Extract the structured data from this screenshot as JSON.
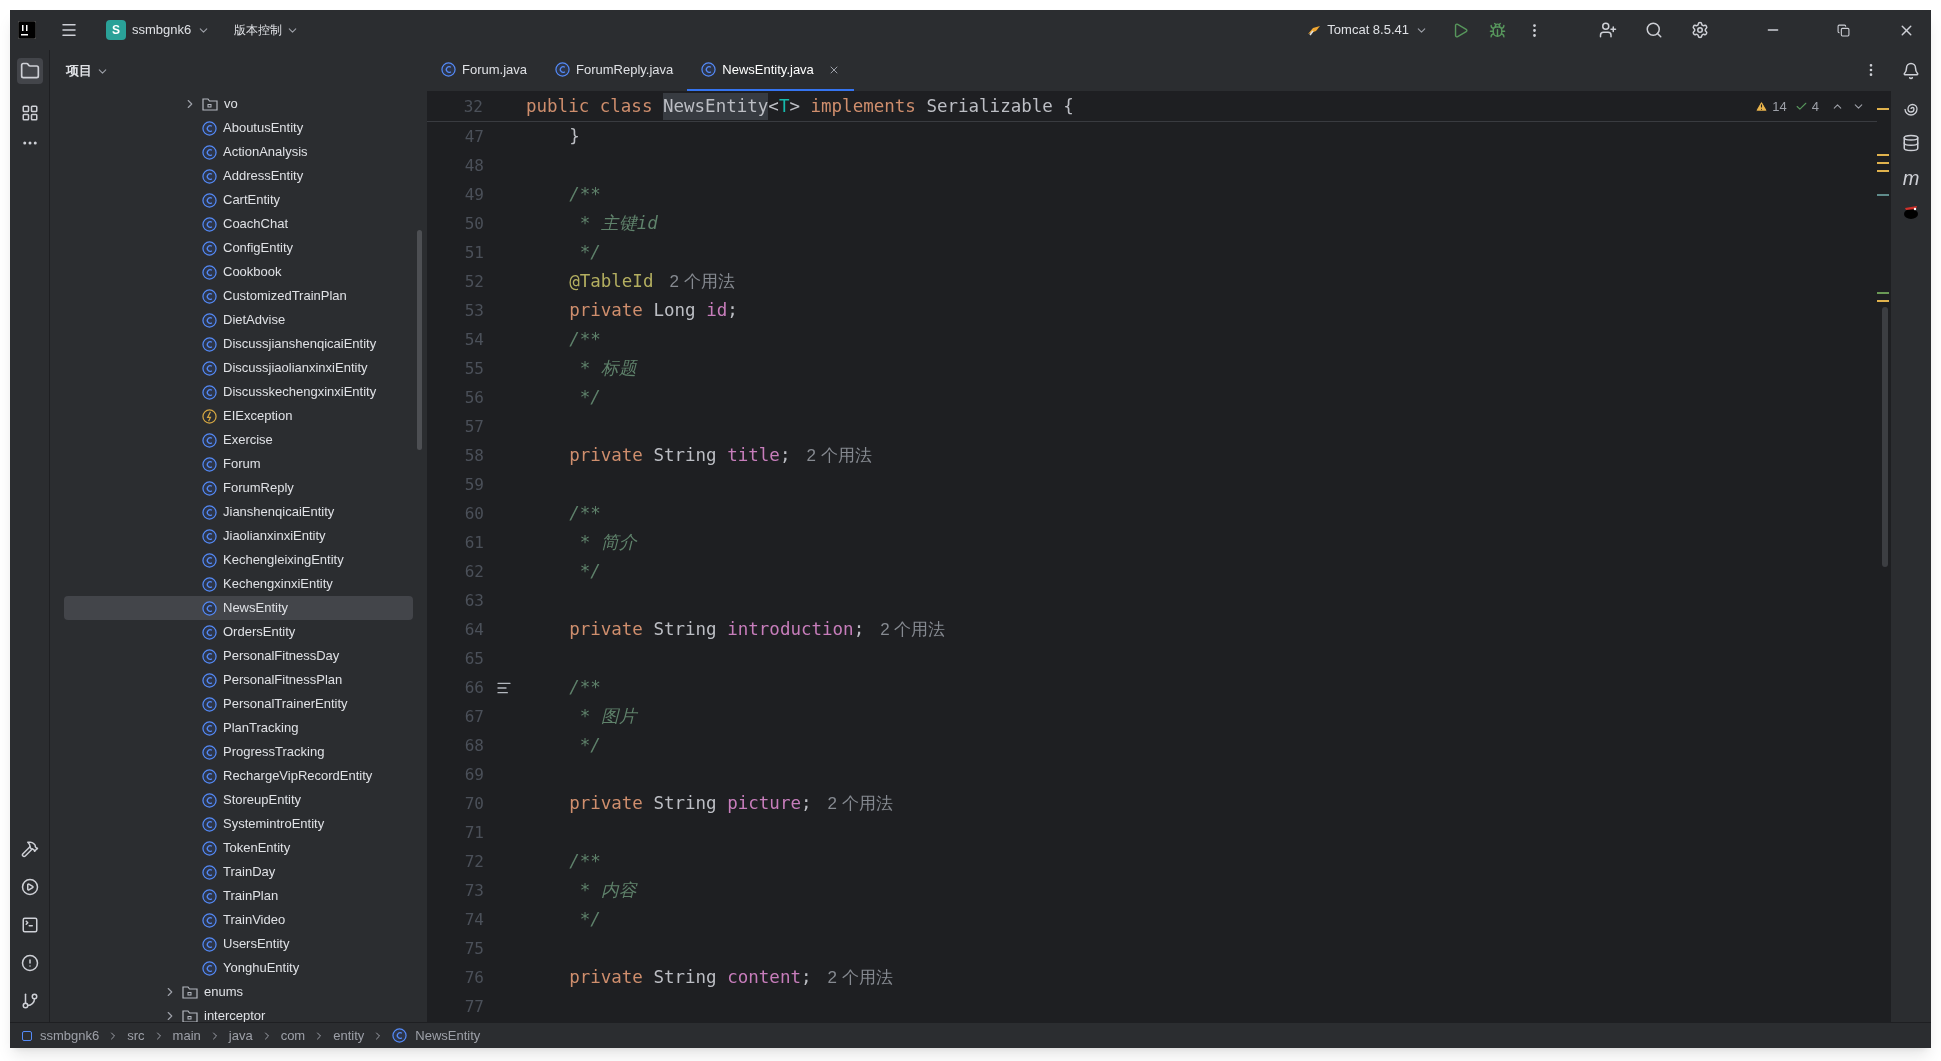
{
  "title_bar": {
    "project_badge": "S",
    "project": "ssmbgnk6",
    "vcs": "版本控制",
    "run_config": "Tomcat 8.5.41"
  },
  "project_panel": {
    "title": "项目",
    "tree": [
      {
        "children": [
          {
            "label": "vo",
            "kind": "folder",
            "expanded": false,
            "selected": false
          },
          {
            "label": "AboutusEntity",
            "kind": "class",
            "selected": false
          },
          {
            "label": "ActionAnalysis",
            "kind": "class",
            "selected": false
          },
          {
            "label": "AddressEntity",
            "kind": "class",
            "selected": false
          },
          {
            "label": "CartEntity",
            "kind": "class",
            "selected": false
          },
          {
            "label": "CoachChat",
            "kind": "class",
            "selected": false
          },
          {
            "label": "ConfigEntity",
            "kind": "class",
            "selected": false
          },
          {
            "label": "Cookbook",
            "kind": "class",
            "selected": false
          },
          {
            "label": "CustomizedTrainPlan",
            "kind": "class",
            "selected": false
          },
          {
            "label": "DietAdvise",
            "kind": "class",
            "selected": false
          },
          {
            "label": "DiscussjianshenqicaiEntity",
            "kind": "class",
            "selected": false
          },
          {
            "label": "DiscussjiaolianxinxiEntity",
            "kind": "class",
            "selected": false
          },
          {
            "label": "DiscusskechengxinxiEntity",
            "kind": "class",
            "selected": false
          },
          {
            "label": "EIException",
            "kind": "exception",
            "selected": false
          },
          {
            "label": "Exercise",
            "kind": "class",
            "selected": false
          },
          {
            "label": "Forum",
            "kind": "class",
            "selected": false
          },
          {
            "label": "ForumReply",
            "kind": "class",
            "selected": false
          },
          {
            "label": "JianshenqicaiEntity",
            "kind": "class",
            "selected": false
          },
          {
            "label": "JiaolianxinxiEntity",
            "kind": "class",
            "selected": false
          },
          {
            "label": "KechengleixingEntity",
            "kind": "class",
            "selected": false
          },
          {
            "label": "KechengxinxiEntity",
            "kind": "class",
            "selected": false
          },
          {
            "label": "NewsEntity",
            "kind": "class",
            "selected": true
          },
          {
            "label": "OrdersEntity",
            "kind": "class",
            "selected": false
          },
          {
            "label": "PersonalFitnessDay",
            "kind": "class",
            "selected": false
          },
          {
            "label": "PersonalFitnessPlan",
            "kind": "class",
            "selected": false
          },
          {
            "label": "PersonalTrainerEntity",
            "kind": "class",
            "selected": false
          },
          {
            "label": "PlanTracking",
            "kind": "class",
            "selected": false
          },
          {
            "label": "ProgressTracking",
            "kind": "class",
            "selected": false
          },
          {
            "label": "RechargeVipRecordEntity",
            "kind": "class",
            "selected": false
          },
          {
            "label": "StoreupEntity",
            "kind": "class",
            "selected": false
          },
          {
            "label": "SystemintroEntity",
            "kind": "class",
            "selected": false
          },
          {
            "label": "TokenEntity",
            "kind": "class",
            "selected": false
          },
          {
            "label": "TrainDay",
            "kind": "class",
            "selected": false
          },
          {
            "label": "TrainPlan",
            "kind": "class",
            "selected": false
          },
          {
            "label": "TrainVideo",
            "kind": "class",
            "selected": false
          },
          {
            "label": "UsersEntity",
            "kind": "class",
            "selected": false
          },
          {
            "label": "YonghuEntity",
            "kind": "class",
            "selected": false
          }
        ]
      },
      {
        "label": "enums",
        "kind": "folder",
        "expanded": false,
        "selected": false
      },
      {
        "label": "interceptor",
        "kind": "folder",
        "expanded": false,
        "selected": false
      }
    ]
  },
  "tabs": [
    {
      "label": "Forum.java",
      "selected": false
    },
    {
      "label": "ForumReply.java",
      "selected": false
    },
    {
      "label": "NewsEntity.java",
      "selected": true
    }
  ],
  "inspections": {
    "warnings": "14",
    "weak_warnings": "4"
  },
  "sticky_line": {
    "number": "32",
    "tokens": [
      {
        "kind": "keyword",
        "text": "public class "
      },
      {
        "kind": "type_highlight",
        "text": "NewsEntity"
      },
      {
        "kind": "plain",
        "text": "<"
      },
      {
        "kind": "generic",
        "text": "T"
      },
      {
        "kind": "plain",
        "text": "> "
      },
      {
        "kind": "keyword",
        "text": "implements "
      },
      {
        "kind": "plain",
        "text": "Serializable {"
      }
    ]
  },
  "code_lines": [
    {
      "number": "47",
      "tokens": [
        {
          "kind": "plain",
          "text": "    }"
        }
      ]
    },
    {
      "number": "48"
    },
    {
      "number": "49",
      "tokens": [
        {
          "kind": "comment",
          "text": "    /**"
        }
      ]
    },
    {
      "number": "50",
      "tokens": [
        {
          "kind": "comment",
          "text": "     * 主键id"
        }
      ]
    },
    {
      "number": "51",
      "tokens": [
        {
          "kind": "comment",
          "text": "     */"
        }
      ]
    },
    {
      "number": "52",
      "tokens": [
        {
          "kind": "annotation",
          "text": "    @TableId"
        },
        {
          "kind": "hint",
          "text": "2 个用法"
        }
      ]
    },
    {
      "number": "53",
      "tokens": [
        {
          "kind": "keyword",
          "text": "    private "
        },
        {
          "kind": "plain",
          "text": "Long "
        },
        {
          "kind": "field",
          "text": "id"
        },
        {
          "kind": "plain",
          "text": ";"
        }
      ]
    },
    {
      "number": "54",
      "tokens": [
        {
          "kind": "comment",
          "text": "    /**"
        }
      ]
    },
    {
      "number": "55",
      "tokens": [
        {
          "kind": "comment",
          "text": "     * 标题"
        }
      ]
    },
    {
      "number": "56",
      "tokens": [
        {
          "kind": "comment",
          "text": "     */"
        }
      ]
    },
    {
      "number": "57"
    },
    {
      "number": "58",
      "tokens": [
        {
          "kind": "keyword",
          "text": "    private "
        },
        {
          "kind": "plain",
          "text": "String "
        },
        {
          "kind": "field",
          "text": "title"
        },
        {
          "kind": "plain",
          "text": ";"
        },
        {
          "kind": "hint",
          "text": "2 个用法"
        }
      ]
    },
    {
      "number": "59"
    },
    {
      "number": "60",
      "tokens": [
        {
          "kind": "comment",
          "text": "    /**"
        }
      ]
    },
    {
      "number": "61",
      "tokens": [
        {
          "kind": "comment",
          "text": "     * 简介"
        }
      ]
    },
    {
      "number": "62",
      "tokens": [
        {
          "kind": "comment",
          "text": "     */"
        }
      ]
    },
    {
      "number": "63"
    },
    {
      "number": "64",
      "tokens": [
        {
          "kind": "keyword",
          "text": "    private "
        },
        {
          "kind": "plain",
          "text": "String "
        },
        {
          "kind": "field",
          "text": "introduction"
        },
        {
          "kind": "plain",
          "text": ";"
        },
        {
          "kind": "hint",
          "text": "2 个用法"
        }
      ]
    },
    {
      "number": "65"
    },
    {
      "number": "66",
      "doc_toggle": true,
      "tokens": [
        {
          "kind": "comment",
          "text": "    /**"
        }
      ]
    },
    {
      "number": "67",
      "tokens": [
        {
          "kind": "comment",
          "text": "     * 图片"
        }
      ]
    },
    {
      "number": "68",
      "tokens": [
        {
          "kind": "comment",
          "text": "     */"
        }
      ]
    },
    {
      "number": "69"
    },
    {
      "number": "70",
      "tokens": [
        {
          "kind": "keyword",
          "text": "    private "
        },
        {
          "kind": "plain",
          "text": "String "
        },
        {
          "kind": "field",
          "text": "picture"
        },
        {
          "kind": "plain",
          "text": ";"
        },
        {
          "kind": "hint",
          "text": "2 个用法"
        }
      ]
    },
    {
      "number": "71"
    },
    {
      "number": "72",
      "tokens": [
        {
          "kind": "comment",
          "text": "    /**"
        }
      ]
    },
    {
      "number": "73",
      "tokens": [
        {
          "kind": "comment",
          "text": "     * 内容"
        }
      ]
    },
    {
      "number": "74",
      "tokens": [
        {
          "kind": "comment",
          "text": "     */"
        }
      ]
    },
    {
      "number": "75"
    },
    {
      "number": "76",
      "tokens": [
        {
          "kind": "keyword",
          "text": "    private "
        },
        {
          "kind": "plain",
          "text": "String "
        },
        {
          "kind": "field",
          "text": "content"
        },
        {
          "kind": "plain",
          "text": ";"
        },
        {
          "kind": "hint",
          "text": "2 个用法"
        }
      ]
    },
    {
      "number": "77"
    }
  ],
  "right_toolbar": {
    "maven_label": "m"
  },
  "breadcrumb": [
    {
      "label": "ssmbgnk6",
      "kind": "module"
    },
    {
      "label": "src",
      "kind": "dir"
    },
    {
      "label": "main",
      "kind": "dir"
    },
    {
      "label": "java",
      "kind": "dir"
    },
    {
      "label": "com",
      "kind": "dir"
    },
    {
      "label": "entity",
      "kind": "dir"
    },
    {
      "label": "NewsEntity",
      "kind": "class"
    }
  ]
}
